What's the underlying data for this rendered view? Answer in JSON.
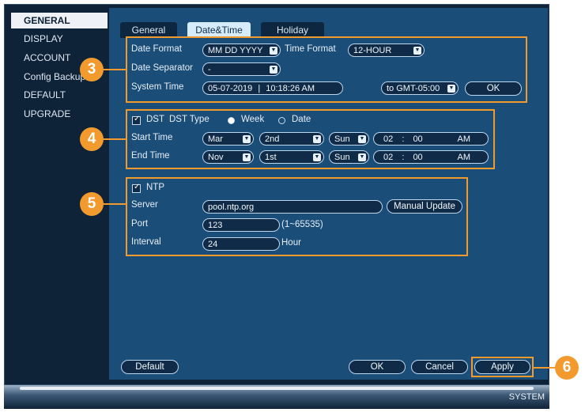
{
  "sidebar": {
    "items": [
      {
        "label": "GENERAL",
        "active": true
      },
      {
        "label": "DISPLAY"
      },
      {
        "label": "ACCOUNT"
      },
      {
        "label": "Config Backup"
      },
      {
        "label": "DEFAULT"
      },
      {
        "label": "UPGRADE"
      }
    ]
  },
  "tabs": [
    {
      "label": "General"
    },
    {
      "label": "Date&Time",
      "active": true
    },
    {
      "label": "Holiday"
    }
  ],
  "datetime": {
    "date_format_label": "Date Format",
    "date_format_value": "MM DD YYYY",
    "time_format_label": "Time Format",
    "time_format_value": "12-HOUR",
    "date_separator_label": "Date Separator",
    "date_separator_value": "-",
    "system_time_label": "System Time",
    "system_date": "05-07-2019",
    "system_time": "10:18:26 AM",
    "timezone_value": "to GMT-05:00",
    "ok_label": "OK"
  },
  "dst": {
    "enable_label": "DST",
    "type_label": "DST Type",
    "type_week": "Week",
    "type_date": "Date",
    "start_label": "Start Time",
    "end_label": "End Time",
    "start": {
      "month": "Mar",
      "week": "2nd",
      "day": "Sun",
      "hour": "02",
      "minute": "00",
      "ampm": "AM"
    },
    "end": {
      "month": "Nov",
      "week": "1st",
      "day": "Sun",
      "hour": "02",
      "minute": "00",
      "ampm": "AM"
    }
  },
  "ntp": {
    "enable_label": "NTP",
    "server_label": "Server",
    "server_value": "pool.ntp.org",
    "manual_update_label": "Manual Update",
    "port_label": "Port",
    "port_value": "123",
    "port_range": "(1~65535)",
    "interval_label": "Interval",
    "interval_value": "24",
    "interval_unit": "Hour"
  },
  "buttons": {
    "default": "Default",
    "ok": "OK",
    "cancel": "Cancel",
    "apply": "Apply"
  },
  "callouts": {
    "dt": "3",
    "dst": "4",
    "ntp": "5",
    "apply": "6"
  },
  "footer": {
    "label": "SYSTEM"
  },
  "colors": {
    "accent": "#f29a2e",
    "panel": "#1a4d78",
    "sidebar": "#0e2238"
  }
}
